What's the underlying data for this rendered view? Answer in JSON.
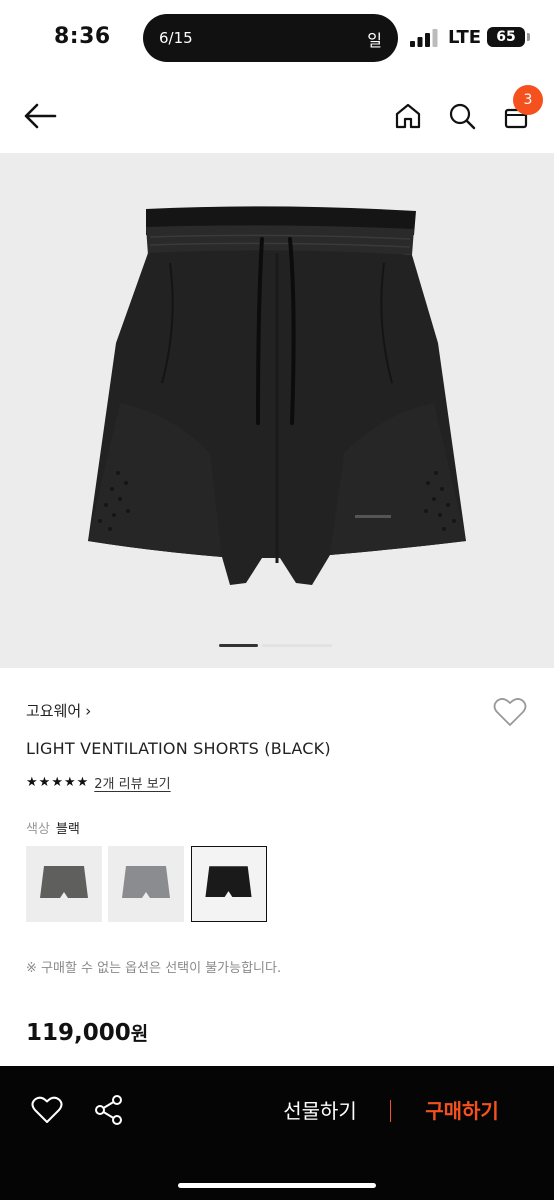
{
  "status_bar": {
    "time": "8:36",
    "island_counter": "6/15",
    "island_label": "일",
    "network": "LTE",
    "battery": "65"
  },
  "nav": {
    "back_icon": "arrow-left-icon",
    "home_icon": "home-icon",
    "search_icon": "search-icon",
    "cart_icon": "shopping-bag-icon",
    "cart_badge": "3",
    "badge_color": "#f4511e"
  },
  "gallery": {
    "current_index": 1,
    "background": "#ececec"
  },
  "product": {
    "brand": "고요웨어",
    "brand_chevron": "›",
    "title": "LIGHT VENTILATION SHORTS (BLACK)",
    "rating_stars": 5,
    "review_link": "2개 리뷰 보기",
    "color_label": "색상",
    "color_value": "블랙",
    "swatches": [
      {
        "name": "gray",
        "color": "#5f605d",
        "selected": false
      },
      {
        "name": "light-gray",
        "color": "#8a8c8f",
        "selected": false
      },
      {
        "name": "black",
        "color": "#1a1a1a",
        "selected": true
      }
    ],
    "option_note": "※ 구매할 수 없는 옵션은 선택이 불가능합니다.",
    "price": "119,000",
    "price_unit": "원"
  },
  "bottom_bar": {
    "gift_label": "선물하기",
    "buy_label": "구매하기",
    "accent_color": "#f4511e"
  }
}
